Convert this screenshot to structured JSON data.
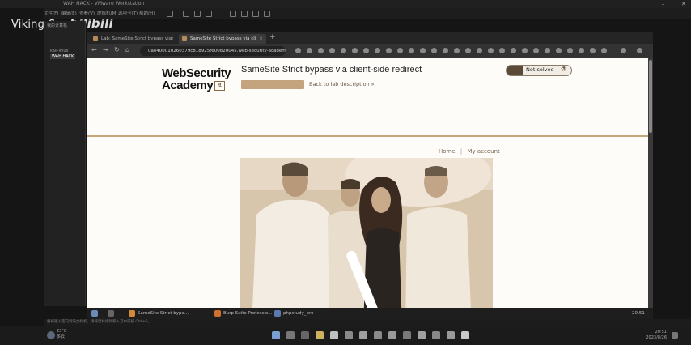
{
  "vmware": {
    "title": "WAH HACK - VMware Workstation",
    "menu": [
      "文件(F)",
      "编辑(E)",
      "查看(V)",
      "虚拟机(M)",
      "选项卡(T)",
      "帮助(H)"
    ],
    "library": {
      "root": "我的计算机",
      "items": [
        "kali-linux",
        "WAH HACK"
      ],
      "selected": "WAH HACK"
    },
    "status": "要将输入定向到该虚拟机，请将鼠标指针移入其中或按 Ctrl+G。"
  },
  "watermark": {
    "channel": "Viking-Sec",
    "logo": "bilibili"
  },
  "browser": {
    "tabs": [
      {
        "label": "Lab: SameSite Strict bypass via",
        "active": false
      },
      {
        "label": "SameSite Strict bypass via cli",
        "active": true
      }
    ],
    "url": "0ae400010260379c818925f600820045.web-security-academy.net",
    "nav": {
      "back": "←",
      "forward": "→",
      "reload": "↻",
      "home": "⌂",
      "new_tab": "+"
    }
  },
  "page": {
    "logo_line1": "WebSecurity",
    "logo_line2": "Academy",
    "logo_mark": "↯",
    "lab_title": "SameSite Strict bypass via client-side redirect",
    "back_link": "Back to lab description",
    "back_arrow": "»",
    "status_label": "Not solved",
    "status_icon": "⚗",
    "nav_home": "Home",
    "nav_sep": "|",
    "nav_account": "My account"
  },
  "guest_taskbar": {
    "items": [
      "SameSite Strict bypa...",
      "Burp Suite Professio...",
      "phpstudy_pro"
    ],
    "time": "20:51"
  },
  "host_taskbar": {
    "weather_temp": "23°C",
    "weather_desc": "多云",
    "time": "20:51",
    "date": "2023/8/26"
  },
  "colors": {
    "accent": "#c4a47e",
    "page_bg": "#fdfcf9",
    "divider": "#c7a67c"
  }
}
